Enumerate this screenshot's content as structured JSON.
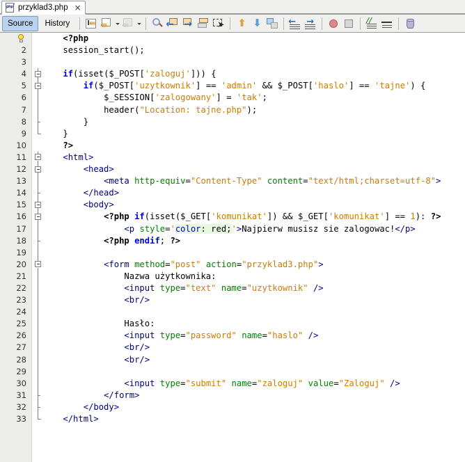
{
  "window": {
    "tab": {
      "filename": "przyklad3.php",
      "icon": "php-file-icon",
      "close": "×"
    }
  },
  "viewbar": {
    "source_label": "Source",
    "history_label": "History"
  },
  "toolbar": {
    "buttons": [
      {
        "name": "last-edit-icon",
        "glyph": "last-edit"
      },
      {
        "name": "back-edit-icon",
        "glyph": "back-edit"
      },
      {
        "name": "back-edit-dropdown-icon",
        "glyph": "chevron-down"
      },
      {
        "name": "forward-edit-icon",
        "glyph": "forward-edit"
      },
      {
        "name": "forward-edit-dropdown-icon",
        "glyph": "chevron-down"
      },
      {
        "name": "find-selection-icon",
        "glyph": "magnifier"
      },
      {
        "name": "find-previous-icon",
        "glyph": "arrow-left"
      },
      {
        "name": "find-next-icon",
        "glyph": "arrow-right"
      },
      {
        "name": "toggle-highlight-icon",
        "glyph": "highlight"
      },
      {
        "name": "toggle-rectangular-selection-icon",
        "glyph": "marquee"
      },
      {
        "name": "previous-bookmark-icon",
        "glyph": "arrow-up-orange"
      },
      {
        "name": "next-bookmark-icon",
        "glyph": "arrow-down-blue"
      },
      {
        "name": "toggle-bookmark-icon",
        "glyph": "bookmark"
      },
      {
        "name": "shift-line-left-icon",
        "glyph": "shift-left"
      },
      {
        "name": "shift-line-right-icon",
        "glyph": "shift-right"
      },
      {
        "name": "start-macro-recording-icon",
        "glyph": "record-red"
      },
      {
        "name": "stop-macro-recording-icon",
        "glyph": "stop-grey"
      },
      {
        "name": "comment-icon",
        "glyph": "comment-lines"
      },
      {
        "name": "uncomment-icon",
        "glyph": "uncomment-lines"
      },
      {
        "name": "database-icon",
        "glyph": "cylinder"
      }
    ]
  },
  "editor": {
    "first_line_marker": "lightbulb-hint-icon",
    "lines": [
      {
        "n": "1",
        "fold": "none",
        "text": "    <?php"
      },
      {
        "n": "2",
        "fold": "none",
        "text": "    session_start();"
      },
      {
        "n": "3",
        "fold": "none",
        "text": ""
      },
      {
        "n": "4",
        "fold": "box",
        "text": "    if(isset($_POST['zaloguj'])) {"
      },
      {
        "n": "5",
        "fold": "box",
        "text": "        if($_POST['uzytkownik'] == 'admin' && $_POST['haslo'] == 'tajne') {"
      },
      {
        "n": "6",
        "fold": "line",
        "text": "            $_SESSION['zalogowany'] = 'tak';"
      },
      {
        "n": "7",
        "fold": "line",
        "text": "            header(\"Location: tajne.php\");"
      },
      {
        "n": "8",
        "fold": "tick",
        "text": "        }"
      },
      {
        "n": "9",
        "fold": "end",
        "text": "    }"
      },
      {
        "n": "10",
        "fold": "none",
        "text": "    ?>"
      },
      {
        "n": "11",
        "fold": "box",
        "text": "    <html>"
      },
      {
        "n": "12",
        "fold": "box",
        "text": "        <head>"
      },
      {
        "n": "13",
        "fold": "line",
        "text": "            <meta http-equiv=\"Content-Type\" content=\"text/html;charset=utf-8\">"
      },
      {
        "n": "14",
        "fold": "tick",
        "text": "        </head>"
      },
      {
        "n": "15",
        "fold": "box",
        "text": "        <body>"
      },
      {
        "n": "16",
        "fold": "box",
        "text": "            <?php if(isset($_GET['komunikat']) && $_GET['komunikat'] == 1): ?>"
      },
      {
        "n": "17",
        "fold": "line",
        "text": "                <p style='color: red;'>Najpierw musisz sie zalogowac!</p>"
      },
      {
        "n": "18",
        "fold": "tick",
        "text": "            <?php endif; ?>"
      },
      {
        "n": "19",
        "fold": "line",
        "text": ""
      },
      {
        "n": "20",
        "fold": "box",
        "text": "            <form method=\"post\" action=\"przyklad3.php\">"
      },
      {
        "n": "21",
        "fold": "line",
        "text": "                Nazwa użytkownika:"
      },
      {
        "n": "22",
        "fold": "line",
        "text": "                <input type=\"text\" name=\"uzytkownik\" />"
      },
      {
        "n": "23",
        "fold": "line",
        "text": "                <br/>"
      },
      {
        "n": "24",
        "fold": "line",
        "text": ""
      },
      {
        "n": "25",
        "fold": "line",
        "text": "                Hasło:"
      },
      {
        "n": "26",
        "fold": "line",
        "text": "                <input type=\"password\" name=\"haslo\" />"
      },
      {
        "n": "27",
        "fold": "line",
        "text": "                <br/>"
      },
      {
        "n": "28",
        "fold": "line",
        "text": "                <br/>"
      },
      {
        "n": "29",
        "fold": "line",
        "text": ""
      },
      {
        "n": "30",
        "fold": "line",
        "text": "                <input type=\"submit\" name=\"zaloguj\" value=\"Zaloguj\" />"
      },
      {
        "n": "31",
        "fold": "tick",
        "text": "            </form>"
      },
      {
        "n": "32",
        "fold": "tick",
        "text": "        </body>"
      },
      {
        "n": "33",
        "fold": "end",
        "text": "    </html>"
      }
    ],
    "code_html": [
      "    <span class=\"php\">&lt;?php</span>",
      "    <span class=\"fn\">session_start</span>();",
      "",
      "    <span class=\"kw\">if</span>(<span class=\"fn\">isset</span>(<span class=\"var\">$_POST</span>[<span class=\"str\">'zaloguj'</span>])) {",
      "        <span class=\"kw\">if</span>(<span class=\"var\">$_POST</span>[<span class=\"str\">'uzytkownik'</span>] == <span class=\"str\">'admin'</span> &amp;&amp; <span class=\"var\">$_POST</span>[<span class=\"str\">'haslo'</span>] == <span class=\"str\">'tajne'</span>) {",
      "            <span class=\"var\">$_SESSION</span>[<span class=\"str\">'zalogowany'</span>] = <span class=\"str\">'tak'</span>;",
      "            <span class=\"fn\">header</span>(<span class=\"str\">\"Location: tajne.php\"</span>);",
      "        }",
      "    }",
      "    <span class=\"php\">?&gt;</span>",
      "    <span class=\"tag\">&lt;html&gt;</span>",
      "        <span class=\"tag\">&lt;head&gt;</span>",
      "            <span class=\"tag\">&lt;meta</span> <span class=\"attr\">http-equiv</span>=<span class=\"str\">\"Content-Type\"</span> <span class=\"attr\">content</span>=<span class=\"str\">\"text/html;charset=utf-8\"</span><span class=\"tag\">&gt;</span>",
      "        <span class=\"tag\">&lt;/head&gt;</span>",
      "        <span class=\"tag\">&lt;body&gt;</span>",
      "            <span class=\"php\">&lt;?php</span> <span class=\"kw\">if</span>(<span class=\"fn\">isset</span>(<span class=\"var\">$_GET</span>[<span class=\"str\">'komunikat'</span>]) &amp;&amp; <span class=\"var\">$_GET</span>[<span class=\"str\">'komunikat'</span>] == <span class=\"num\">1</span>): <span class=\"php\">?&gt;</span>",
      "                <span class=\"tag\">&lt;p</span> <span class=\"attr\">style</span>=<span class=\"str\">'</span><span class=\"csshl\"><span class=\"cssprop\">color</span>: red;</span><span class=\"str\">'</span><span class=\"tag\">&gt;</span>Najpierw musisz sie zalogowac!<span class=\"tag\">&lt;/p&gt;</span>",
      "            <span class=\"php\">&lt;?php</span> <span class=\"kw\">endif</span>; <span class=\"php\">?&gt;</span>",
      "",
      "            <span class=\"tag\">&lt;form</span> <span class=\"attr\">method</span>=<span class=\"str\">\"post\"</span> <span class=\"attr\">action</span>=<span class=\"str\">\"przyklad3.php\"</span><span class=\"tag\">&gt;</span>",
      "                Nazwa użytkownika:",
      "                <span class=\"tag\">&lt;input</span> <span class=\"attr\">type</span>=<span class=\"str\">\"text\"</span> <span class=\"attr\">name</span>=<span class=\"str\">\"uzytkownik\"</span> <span class=\"tag\">/&gt;</span>",
      "                <span class=\"tag\">&lt;br/&gt;</span>",
      "",
      "                Hasło:",
      "                <span class=\"tag\">&lt;input</span> <span class=\"attr\">type</span>=<span class=\"str\">\"password\"</span> <span class=\"attr\">name</span>=<span class=\"str\">\"haslo\"</span> <span class=\"tag\">/&gt;</span>",
      "                <span class=\"tag\">&lt;br/&gt;</span>",
      "                <span class=\"tag\">&lt;br/&gt;</span>",
      "",
      "                <span class=\"tag\">&lt;input</span> <span class=\"attr\">type</span>=<span class=\"str\">\"submit\"</span> <span class=\"attr\">name</span>=<span class=\"str\">\"zaloguj\"</span> <span class=\"attr\">value</span>=<span class=\"str\">\"Zaloguj\"</span> <span class=\"tag\">/&gt;</span>",
      "            <span class=\"tag\">&lt;/form&gt;</span>",
      "        <span class=\"tag\">&lt;/body&gt;</span>",
      "    <span class=\"tag\">&lt;/html&gt;</span>"
    ]
  },
  "colors": {
    "tab_selected_bg": "#b9d3ee",
    "toolbar_bg": "#f0f0ee",
    "gutter_bg": "#ececeb",
    "keyword": "#0000e6",
    "tag": "#000080",
    "attribute": "#008000",
    "string": "#ce7b00",
    "css_highlight_bg": "#e8f7e0"
  }
}
